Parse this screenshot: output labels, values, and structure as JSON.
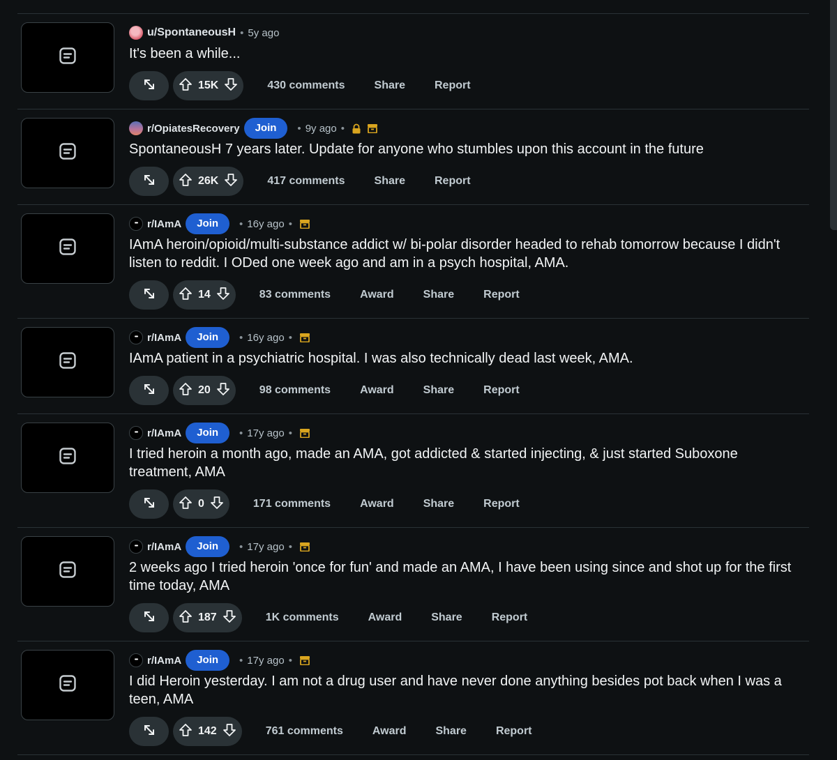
{
  "posts": [
    {
      "type": "user",
      "author": "u/SpontaneousH",
      "time": "5y ago",
      "title": "It's been a while...",
      "votes": "15K",
      "comments": "430 comments",
      "actions": [
        "Share",
        "Report"
      ],
      "icons": []
    },
    {
      "type": "sub",
      "avatar": "opiates",
      "subreddit": "r/OpiatesRecovery",
      "join": "Join",
      "time": "9y ago",
      "title": "SpontaneousH 7 years later. Update for anyone who stumbles upon this account in the future",
      "votes": "26K",
      "comments": "417 comments",
      "actions": [
        "Share",
        "Report"
      ],
      "icons": [
        "lock-icon",
        "archive-icon"
      ]
    },
    {
      "type": "sub",
      "avatar": "iama",
      "subreddit": "r/IAmA",
      "join": "Join",
      "time": "16y ago",
      "title": "IAmA heroin/opioid/multi-substance addict w/ bi-polar disorder headed to rehab tomorrow because I didn't listen to reddit. I ODed one week ago and am in a psych hospital, AMA.",
      "votes": "14",
      "comments": "83 comments",
      "actions": [
        "Award",
        "Share",
        "Report"
      ],
      "icons": [
        "archive-icon"
      ]
    },
    {
      "type": "sub",
      "avatar": "iama",
      "subreddit": "r/IAmA",
      "join": "Join",
      "time": "16y ago",
      "title": "IAmA patient in a psychiatric hospital. I was also technically dead last week, AMA.",
      "votes": "20",
      "comments": "98 comments",
      "actions": [
        "Award",
        "Share",
        "Report"
      ],
      "icons": [
        "archive-icon"
      ]
    },
    {
      "type": "sub",
      "avatar": "iama",
      "subreddit": "r/IAmA",
      "join": "Join",
      "time": "17y ago",
      "title": "I tried heroin a month ago, made an AMA, got addicted & started injecting, & just started Suboxone treatment, AMA",
      "votes": "0",
      "comments": "171 comments",
      "actions": [
        "Award",
        "Share",
        "Report"
      ],
      "icons": [
        "archive-icon"
      ]
    },
    {
      "type": "sub",
      "avatar": "iama",
      "subreddit": "r/IAmA",
      "join": "Join",
      "time": "17y ago",
      "title": "2 weeks ago I tried heroin 'once for fun' and made an AMA, I have been using since and shot up for the first time today, AMA",
      "votes": "187",
      "comments": "1K comments",
      "actions": [
        "Award",
        "Share",
        "Report"
      ],
      "icons": [
        "archive-icon"
      ]
    },
    {
      "type": "sub",
      "avatar": "iama",
      "subreddit": "r/IAmA",
      "join": "Join",
      "time": "17y ago",
      "title": "I did Heroin yesterday. I am not a drug user and have never done anything besides pot back when I was a teen, AMA",
      "votes": "142",
      "comments": "761 comments",
      "actions": [
        "Award",
        "Share",
        "Report"
      ],
      "icons": [
        "archive-icon"
      ]
    }
  ],
  "colors": {
    "background": "#0e1113",
    "join": "#1f5fd1",
    "pill": "#2a3236",
    "lock": "#d9a51f",
    "archive": "#d9a51f"
  }
}
